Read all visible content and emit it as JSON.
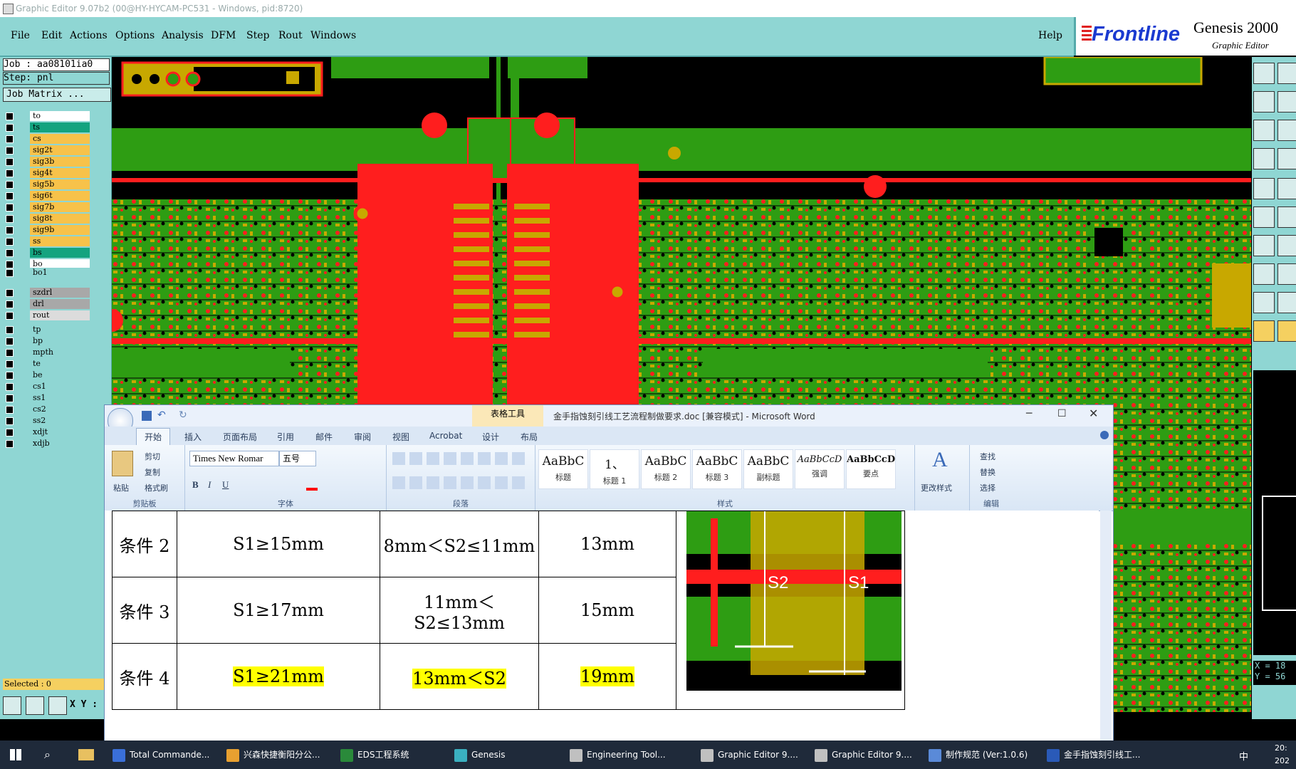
{
  "titlebar": {
    "text": "Graphic Editor 9.07b2 (00@HY-HYCAM-PC531 - Windows, pid:8720)"
  },
  "menu": [
    "File",
    "Edit",
    "Actions",
    "Options",
    "Analysis",
    "DFM",
    "Step",
    "Rout",
    "Windows"
  ],
  "help": "Help",
  "brand": {
    "logo": "Frontline",
    "product": "Genesis 2000",
    "sub": "Graphic Editor"
  },
  "job": {
    "job_line": "Job : aa08101ia0",
    "step_line": "Step: pnl",
    "matrix_button": "Job Matrix ..."
  },
  "layers_a": [
    "to",
    "ts",
    "cs",
    "sig2t",
    "sig3b",
    "sig4t",
    "sig5b",
    "sig6t",
    "sig7b",
    "sig8t",
    "sig9b",
    "ss",
    "bs",
    "bo"
  ],
  "layers_b": [
    "bo1"
  ],
  "layers_c": [
    "szdrl",
    "drl",
    "rout"
  ],
  "layers_d": [
    "tp",
    "bp",
    "mpth",
    "te",
    "be",
    "cs1",
    "ss1",
    "cs2",
    "ss2",
    "xdjt",
    "xdjb"
  ],
  "colors": {
    "to": "#ffffff",
    "ts": "#14a37f",
    "cs": "#f7c24a",
    "sig": "#f7c24a",
    "ss": "#f7c24a",
    "bs": "#14a37f",
    "bo": "#ffffff",
    "bo1": "#8fd6d3",
    "szdrl": "#a8a8a8",
    "drl": "#a8a8a8",
    "rout": "#dcdcdc",
    "d": "#8fd6d3",
    "pcb_green": "#2e9d13",
    "pcb_red": "#ff1e1e",
    "pcb_gold": "#c8a800"
  },
  "selected": "Selected : 0",
  "xy_label": "X Y :",
  "coords": {
    "x": "X = 18",
    "y": "Y = 56"
  },
  "word": {
    "table_tools": "表格工具",
    "title": "金手指蚀刻引线工艺流程制做要求.doc [兼容模式] - Microsoft Word",
    "tabs": [
      "开始",
      "插入",
      "页面布局",
      "引用",
      "邮件",
      "审阅",
      "视图",
      "Acrobat",
      "设计",
      "布局"
    ],
    "clipboard": {
      "paste": "粘贴",
      "cut": "剪切",
      "copy": "复制",
      "painter": "格式刷",
      "label": "剪贴板"
    },
    "font": {
      "name": "Times New Romar",
      "size": "五号",
      "label": "字体"
    },
    "paragraph_label": "段落",
    "styles": [
      {
        "preview": "AaBbC",
        "name": "标题"
      },
      {
        "preview": "1、",
        "name": "标题 1"
      },
      {
        "preview": "AaBbC",
        "name": "标题 2"
      },
      {
        "preview": "AaBbC",
        "name": "标题 3"
      },
      {
        "preview": "AaBbC",
        "name": "副标题"
      },
      {
        "preview": "AaBbCcD",
        "name": "强调"
      },
      {
        "preview": "AaBbCcD",
        "name": "要点"
      }
    ],
    "styles_label": "样式",
    "change_styles": "更改样式",
    "editing": {
      "find": "查找",
      "replace": "替换",
      "select": "选择",
      "label": "编辑"
    },
    "table": [
      [
        "条件 2",
        "S1≥15mm",
        "8mm＜S2≤11mm",
        "13mm"
      ],
      [
        "条件 3",
        "S1≥17mm",
        "11mm＜S2≤13mm",
        "15mm"
      ],
      [
        "条件 4",
        "S1≥21mm",
        "13mm＜S2",
        "19mm"
      ]
    ],
    "diagram": {
      "s2": "S2",
      "s1": "S1"
    }
  },
  "taskbar": [
    {
      "label": "Total Commande...",
      "color": "#3a6fd8"
    },
    {
      "label": "兴森快捷衡阳分公...",
      "color": "#e8a030"
    },
    {
      "label": "EDS工程系统",
      "color": "#2a8a3a"
    },
    {
      "label": "Genesis",
      "color": "#3ab0c0"
    },
    {
      "label": "Engineering Tool...",
      "color": "#c0c0c0"
    },
    {
      "label": "Graphic Editor 9....",
      "color": "#c0c0c0"
    },
    {
      "label": "Graphic Editor 9....",
      "color": "#c0c0c0"
    },
    {
      "label": "制作规范 (Ver:1.0.6)",
      "color": "#5a8ad8"
    },
    {
      "label": "金手指蚀刻引线工...",
      "color": "#2a5ab8"
    }
  ],
  "tray": {
    "ime": "中",
    "time": "20:",
    "date": "202"
  }
}
